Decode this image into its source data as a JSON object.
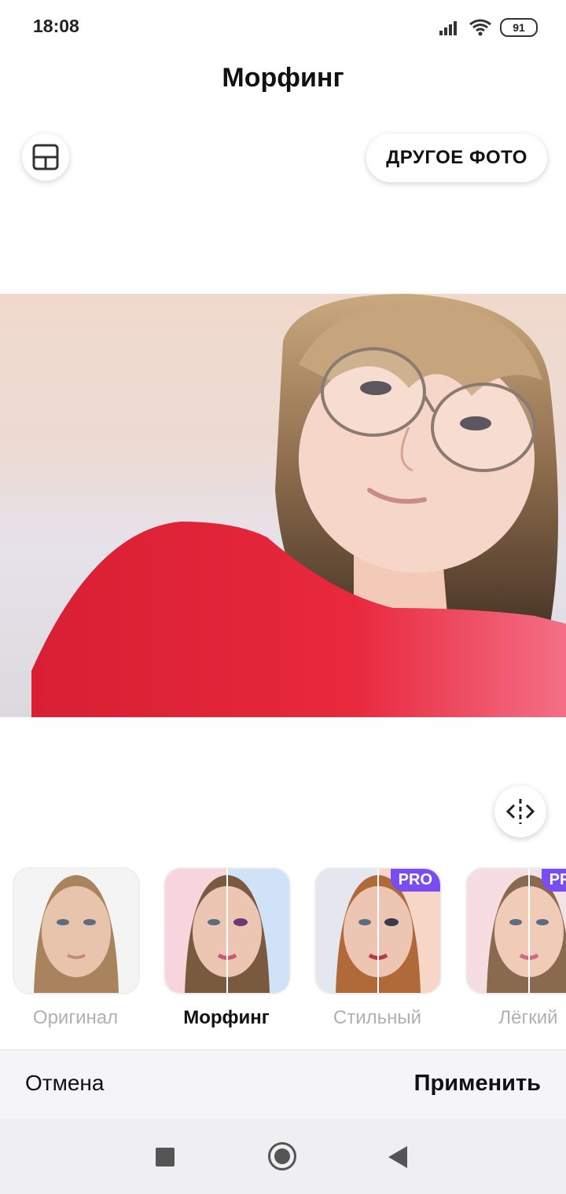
{
  "status_bar": {
    "time": "18:08",
    "battery": "91"
  },
  "header": {
    "title": "Морфинг"
  },
  "toolbar": {
    "other_photo_label": "ДРУГОЕ ФОТО"
  },
  "filters": [
    {
      "label": "Оригинал",
      "pro": ""
    },
    {
      "label": "Морфинг",
      "pro": ""
    },
    {
      "label": "Стильный",
      "pro": "PRO"
    },
    {
      "label": "Лёгкий",
      "pro": "PRO"
    }
  ],
  "bottom_bar": {
    "cancel_label": "Отмена",
    "apply_label": "Применить"
  },
  "colors": {
    "pro_badge": "#7a4df2",
    "shirt": "#e5263a"
  }
}
